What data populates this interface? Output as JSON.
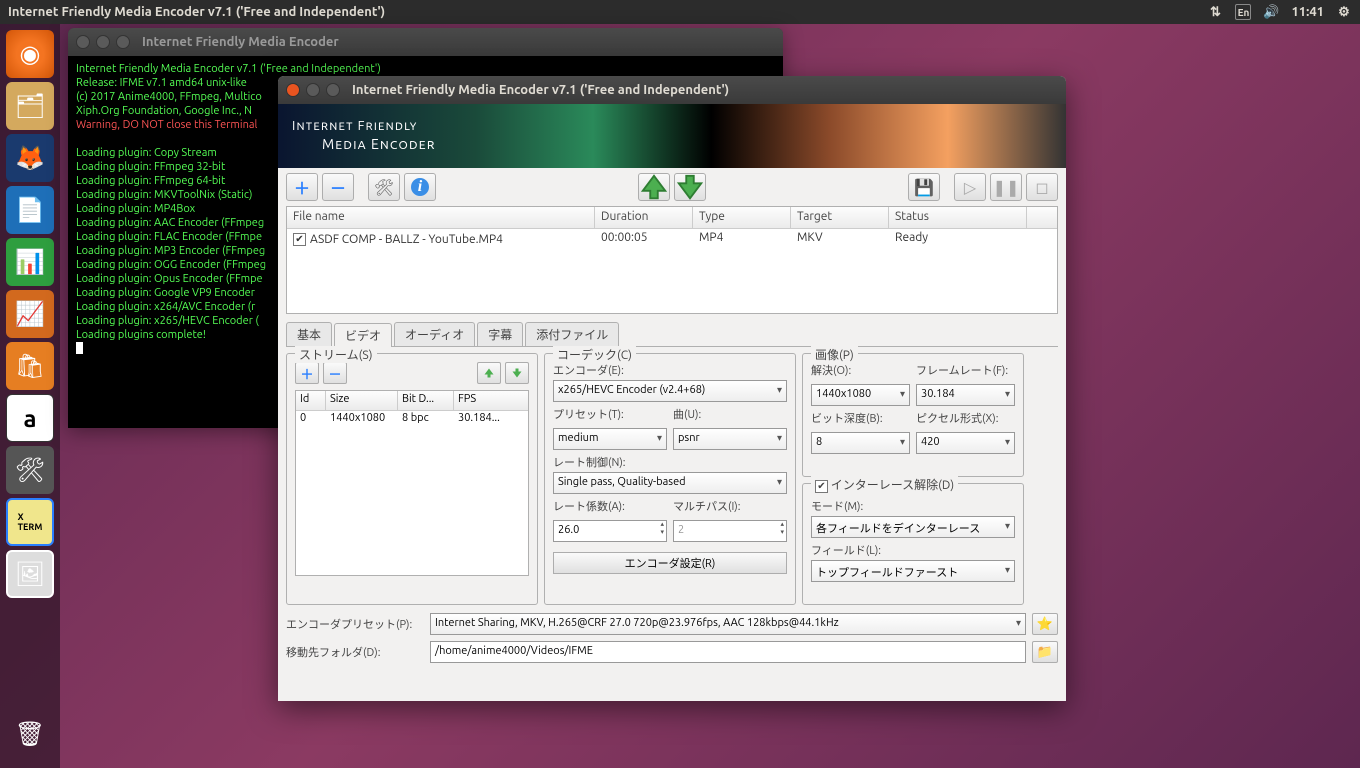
{
  "menubar": {
    "title": "Internet Friendly Media Encoder v7.1 ('Free and Independent')",
    "lang": "En",
    "time": "11:41"
  },
  "terminal": {
    "title": "Internet Friendly Media Encoder",
    "lines": [
      "Internet Friendly Media Encoder v7.1 ('Free and Independent')",
      "Release: IFME v7.1 amd64 unix-like",
      "",
      "(c) 2017 Anime4000, FFmpeg, Multico",
      "Xiph.Org Foundation, Google Inc., N",
      ""
    ],
    "warn": "Warning, DO NOT close this Terminal",
    "plugins": [
      "Loading plugin: Copy Stream",
      "Loading plugin: FFmpeg 32-bit",
      "Loading plugin: FFmpeg 64-bit",
      "Loading plugin: MKVToolNix (Static)",
      "Loading plugin: MP4Box",
      "Loading plugin: AAC Encoder (FFmpeg",
      "Loading plugin: FLAC Encoder (FFmpe",
      "Loading plugin: MP3 Encoder (FFmpeg",
      "Loading plugin: OGG Encoder (FFmpeg",
      "Loading plugin: Opus Encoder (FFmpe",
      "Loading plugin: Google VP9 Encoder",
      "Loading plugin: x264/AVC Encoder (r",
      "Loading plugin: x265/HEVC Encoder (",
      "Loading plugins complete!"
    ]
  },
  "app": {
    "title": "Internet Friendly Media Encoder v7.1 ('Free and Independent')",
    "banner1": "Internet Friendly",
    "banner2": "Media Encoder",
    "filelist": {
      "headers": [
        "File name",
        "Duration",
        "Type",
        "Target",
        "Status"
      ],
      "row": {
        "filename": "ASDF COMP - BALLZ - YouTube.MP4",
        "duration": "00:00:05",
        "type": "MP4",
        "target": "MKV",
        "status": "Ready"
      }
    },
    "tabs": [
      "基本",
      "ビデオ",
      "オーディオ",
      "字幕",
      "添付ファイル"
    ],
    "stream": {
      "legend": "ストリーム(S)",
      "headers": [
        "Id",
        "Size",
        "Bit D...",
        "FPS"
      ],
      "row": {
        "id": "0",
        "size": "1440x1080",
        "bitd": "8 bpc",
        "fps": "30.184..."
      }
    },
    "codec": {
      "legend": "コーデック(C)",
      "encoder_label": "エンコーダ(E):",
      "encoder": "x265/HEVC Encoder (v2.4+68)",
      "preset_label": "プリセット(T):",
      "preset": "medium",
      "tune_label": "曲(U):",
      "tune": "psnr",
      "rate_label": "レート制御(N):",
      "rate": "Single pass, Quality-based",
      "crf_label": "レート係数(A):",
      "crf": "26.0",
      "multi_label": "マルチパス(I):",
      "multi": "2",
      "encset": "エンコーダ設定(R)"
    },
    "picture": {
      "legend": "画像(P)",
      "res_label": "解決(O):",
      "res": "1440x1080",
      "fps_label": "フレームレート(F):",
      "fps": "30.184",
      "bit_label": "ビット深度(B):",
      "bit": "8",
      "pix_label": "ピクセル形式(X):",
      "pix": "420"
    },
    "deint": {
      "legend": "インターレース解除(D)",
      "mode_label": "モード(M):",
      "mode": "各フィールドをデインターレース",
      "field_label": "フィールド(L):",
      "field": "トップフィールドファースト"
    },
    "bottom": {
      "preset_label": "エンコーダプリセット(P):",
      "preset": "Internet Sharing, MKV, H.265@CRF 27.0 720p@23.976fps, AAC 128kbps@44.1kHz",
      "dest_label": "移動先フォルダ(D):",
      "dest": "/home/anime4000/Videos/IFME"
    }
  }
}
